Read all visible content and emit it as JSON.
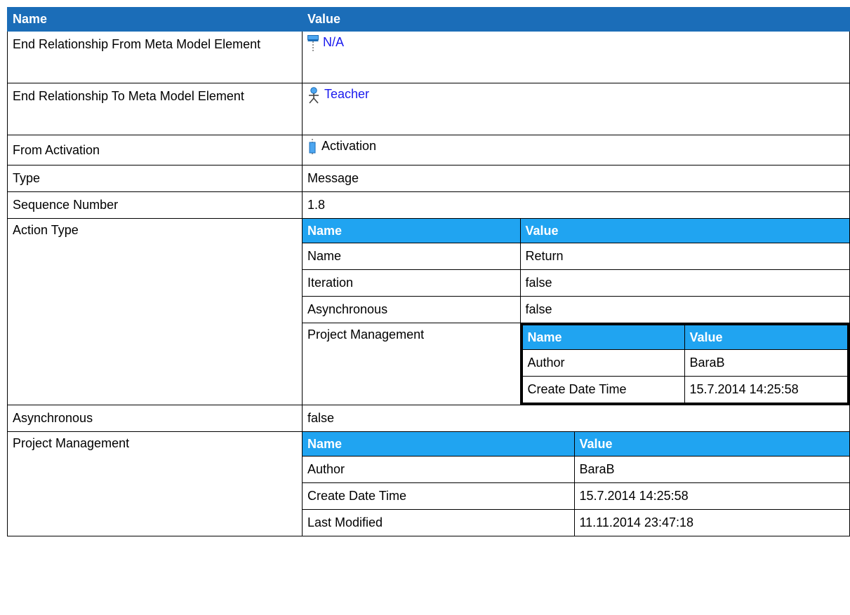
{
  "header": {
    "name": "Name",
    "value": "Value"
  },
  "rows": {
    "end_from": {
      "name": "End Relationship From Meta Model Element",
      "value": "N/A",
      "icon": "lifeline-icon"
    },
    "end_to": {
      "name": "End Relationship To Meta Model Element",
      "value": "Teacher",
      "icon": "actor-icon"
    },
    "from_activation": {
      "name": "From Activation",
      "value": "Activation",
      "icon": "activation-icon"
    },
    "type": {
      "name": "Type",
      "value": "Message"
    },
    "seq": {
      "name": "Sequence Number",
      "value": "1.8"
    },
    "action_type": {
      "name": "Action Type",
      "header": {
        "name": "Name",
        "value": "Value"
      },
      "name_row": {
        "name": "Name",
        "value": "Return"
      },
      "iteration": {
        "name": "Iteration",
        "value": "false"
      },
      "asynchronous": {
        "name": "Asynchronous",
        "value": "false"
      },
      "pm": {
        "name": "Project Management",
        "header": {
          "name": "Name",
          "value": "Value"
        },
        "author": {
          "name": "Author",
          "value": "BaraB"
        },
        "created": {
          "name": "Create Date Time",
          "value": "15.7.2014 14:25:58"
        }
      }
    },
    "asynchronous": {
      "name": "Asynchronous",
      "value": "false"
    },
    "pm": {
      "name": "Project Management",
      "header": {
        "name": "Name",
        "value": "Value"
      },
      "author": {
        "name": "Author",
        "value": "BaraB"
      },
      "created": {
        "name": "Create Date Time",
        "value": "15.7.2014 14:25:58"
      },
      "modified": {
        "name": "Last Modified",
        "value": "11.11.2014 23:47:18"
      }
    }
  },
  "colors": {
    "header_bg": "#1b6db8",
    "subheader_bg": "#20a4f1",
    "link": "#1a1aee"
  }
}
